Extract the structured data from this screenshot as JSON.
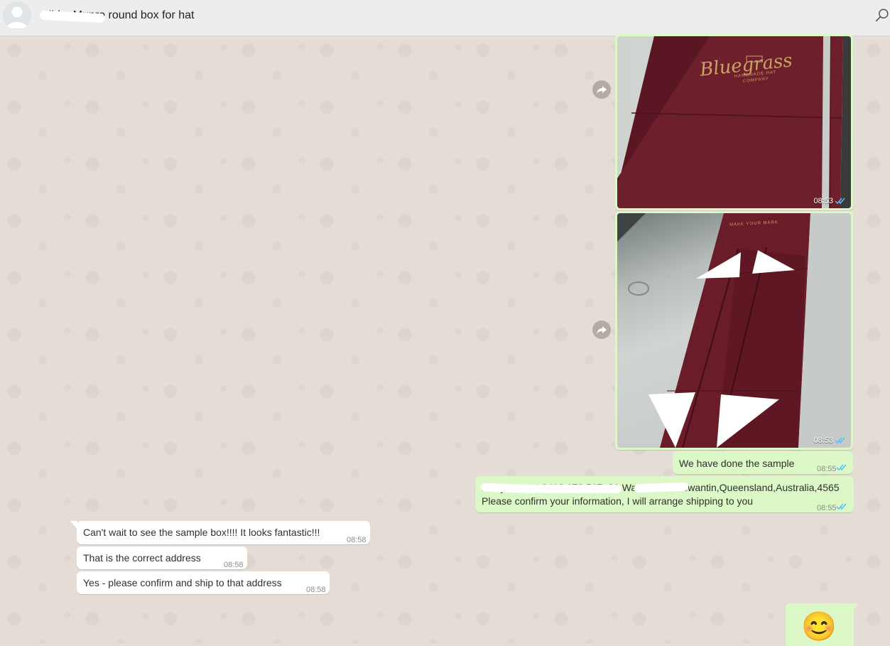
{
  "header": {
    "contact_title": "Libby Munro round box for hat"
  },
  "messages": [
    {
      "type": "image",
      "direction": "outgoing",
      "time": "08:53",
      "logo_text": "Bluegrass",
      "logo_subtext": "HANDMADE HAT COMPANY"
    },
    {
      "type": "image",
      "direction": "outgoing",
      "time": "08:53",
      "imprint_text": "MAKE YOUR MARK"
    },
    {
      "type": "text",
      "direction": "outgoing",
      "text": "We have done the sample",
      "time": "08:55"
    },
    {
      "type": "text",
      "direction": "outgoing",
      "line1": "Libby Munro, 0412 173 567, 21 Ward Street Tewantin,Queensland,Australia,4565",
      "line2": "Please confirm your information, I will arrange shipping to you",
      "time": "08:55"
    },
    {
      "type": "text",
      "direction": "incoming",
      "text": "Can't wait to see the sample box!!!! It looks fantastic!!!",
      "time": "08:58"
    },
    {
      "type": "text",
      "direction": "incoming",
      "text": "That is the correct address",
      "time": "08:58"
    },
    {
      "type": "text",
      "direction": "incoming",
      "text": "Yes - please confirm and ship to that address",
      "time": "08:58"
    },
    {
      "type": "emoji",
      "direction": "outgoing",
      "text": "😊"
    }
  ],
  "colors": {
    "outgoing_bubble": "#dcf8c6",
    "incoming_bubble": "#ffffff",
    "read_ticks": "#4fc3f7",
    "chat_background": "#e5ddd5",
    "header_background": "#ededed"
  },
  "icons": [
    "avatar-icon",
    "search-icon",
    "forward-icon",
    "double-check-icon"
  ]
}
